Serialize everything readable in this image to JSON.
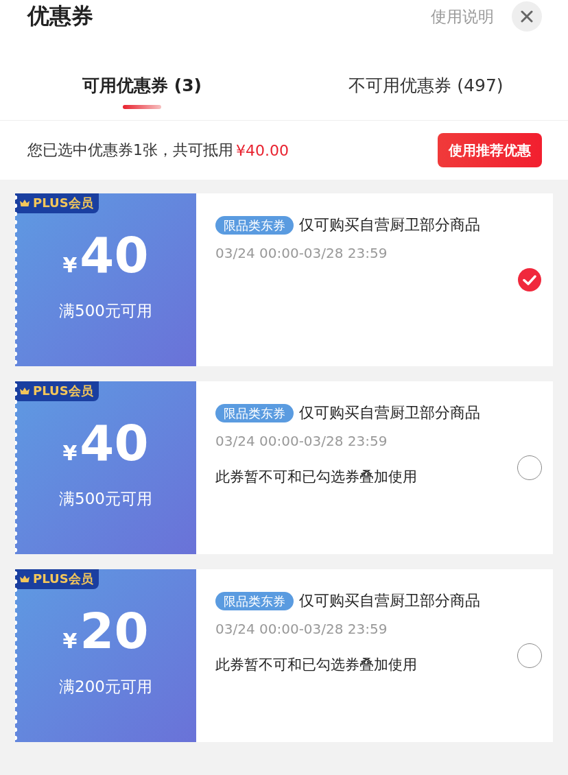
{
  "header": {
    "title": "优惠券",
    "help_link": "使用说明"
  },
  "tabs": [
    {
      "label": "可用优惠券 (3)",
      "selected": true
    },
    {
      "label": "不可用优惠券 (497)",
      "selected": false
    }
  ],
  "summary": {
    "text": "您已选中优惠券1张，共可抵用",
    "amount": "¥40.00",
    "button": "使用推荐优惠"
  },
  "coupons": [
    {
      "badge": "PLUS会员",
      "currency": "¥",
      "value": "40",
      "condition": "满500元可用",
      "tag": "限品类东券",
      "description": "仅可购买自营厨卫部分商品",
      "validity": "03/24 00:00-03/28 23:59",
      "selected": true
    },
    {
      "badge": "PLUS会员",
      "currency": "¥",
      "value": "40",
      "condition": "满500元可用",
      "tag": "限品类东券",
      "description": "仅可购买自营厨卫部分商品",
      "validity": "03/24 00:00-03/28 23:59",
      "note": "此券暂不可和已勾选券叠加使用",
      "selected": false
    },
    {
      "badge": "PLUS会员",
      "currency": "¥",
      "value": "20",
      "condition": "满200元可用",
      "tag": "限品类东券",
      "description": "仅可购买自营厨卫部分商品",
      "validity": "03/24 00:00-03/28 23:59",
      "note": "此券暂不可和已勾选券叠加使用",
      "selected": false
    }
  ]
}
